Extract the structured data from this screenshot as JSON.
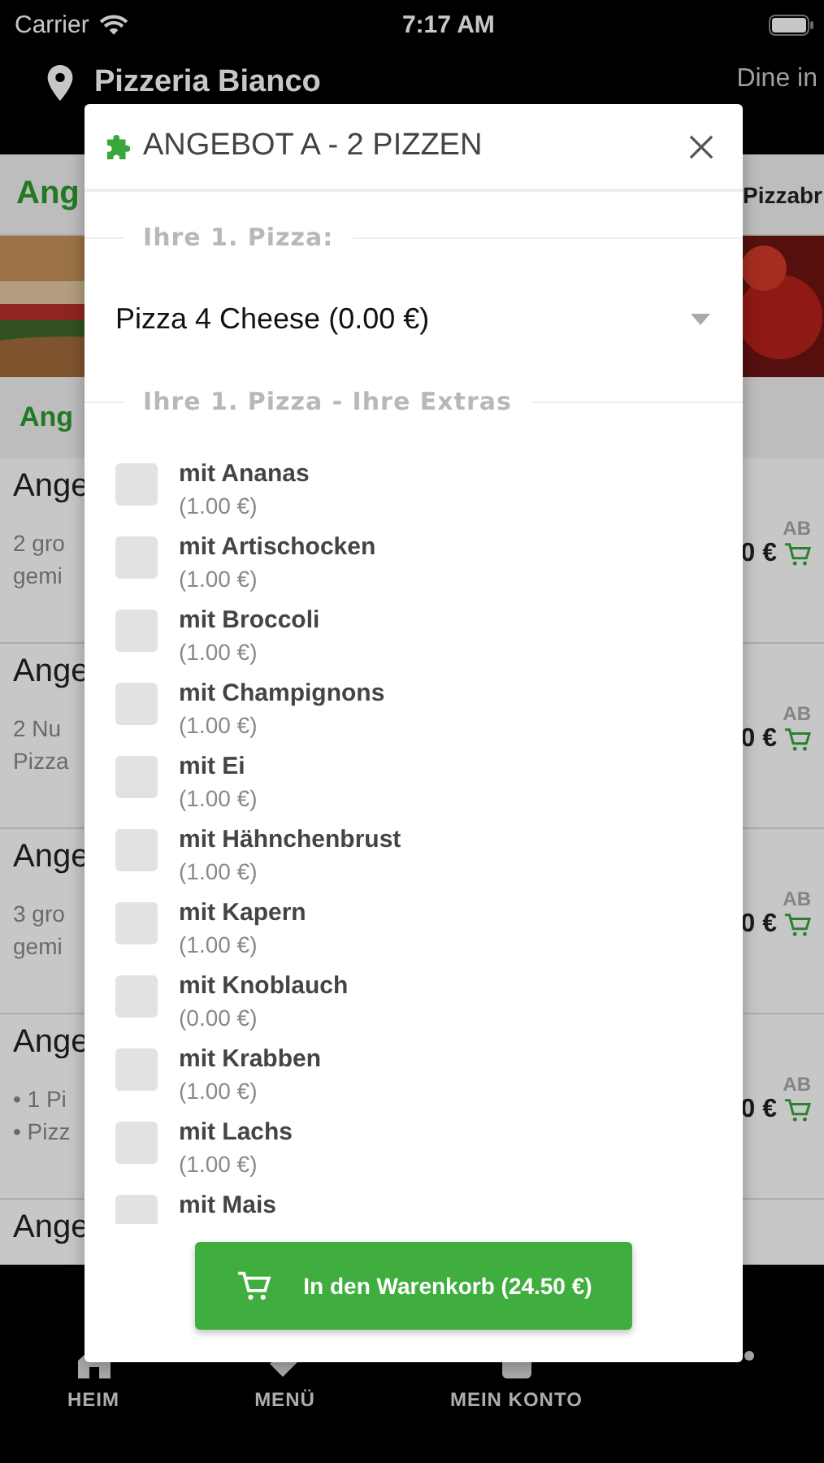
{
  "status_bar": {
    "carrier": "Carrier",
    "time": "7:17 AM"
  },
  "header": {
    "restaurant": "Pizzeria Bianco",
    "mode": "Dine in"
  },
  "category_tabs": [
    {
      "label": "Ang",
      "selected": true
    },
    {
      "label": "Pizzabr",
      "selected": false
    }
  ],
  "subcategory": {
    "label": "Ang"
  },
  "menu_items": [
    {
      "title": "Ange",
      "lines": [
        "2 gro",
        "gemi"
      ],
      "from": "AB",
      "price": "0 €"
    },
    {
      "title": "Ange",
      "lines": [
        "2 Nu",
        "Pizza"
      ],
      "from": "AB",
      "price": "0 €"
    },
    {
      "title": "Ange",
      "lines": [
        "3 gro",
        "gemi"
      ],
      "from": "AB",
      "price": "0 €"
    },
    {
      "title": "Ange",
      "lines": [
        "• 1 Pi",
        "• Pizz"
      ],
      "from": "AB",
      "price": "0 €"
    },
    {
      "title": "Ange"
    }
  ],
  "dialog": {
    "title": "ANGEBOT A - 2 PIZZEN",
    "pizza_legend": "Ihre 1. Pizza:",
    "pizza_select": {
      "value": "Pizza 4 Cheese (0.00 €)"
    },
    "extras_legend": "Ihre 1. Pizza - Ihre Extras",
    "extras": [
      {
        "name": "mit Ananas",
        "price": "(1.00 €)",
        "checked": false
      },
      {
        "name": "mit Artischocken",
        "price": "(1.00 €)",
        "checked": false
      },
      {
        "name": "mit Broccoli",
        "price": "(1.00 €)",
        "checked": false
      },
      {
        "name": "mit Champignons",
        "price": "(1.00 €)",
        "checked": false
      },
      {
        "name": "mit Ei",
        "price": "(1.00 €)",
        "checked": false
      },
      {
        "name": "mit Hähnchenbrust",
        "price": "(1.00 €)",
        "checked": false
      },
      {
        "name": "mit Kapern",
        "price": "(1.00 €)",
        "checked": false
      },
      {
        "name": "mit Knoblauch",
        "price": "(0.00 €)",
        "checked": false
      },
      {
        "name": "mit Krabben",
        "price": "(1.00 €)",
        "checked": false
      },
      {
        "name": "mit Lachs",
        "price": "(1.00 €)",
        "checked": false
      },
      {
        "name": "mit Mais",
        "checked": false
      }
    ],
    "add_button": "In den Warenkorb (24.50 €)"
  },
  "bottom_nav": [
    {
      "kind": "home",
      "label": "HEIM"
    },
    {
      "kind": "tag",
      "label": "MENÜ"
    },
    {
      "kind": "account",
      "label": "MEIN KONTO"
    },
    {
      "kind": "more"
    }
  ]
}
